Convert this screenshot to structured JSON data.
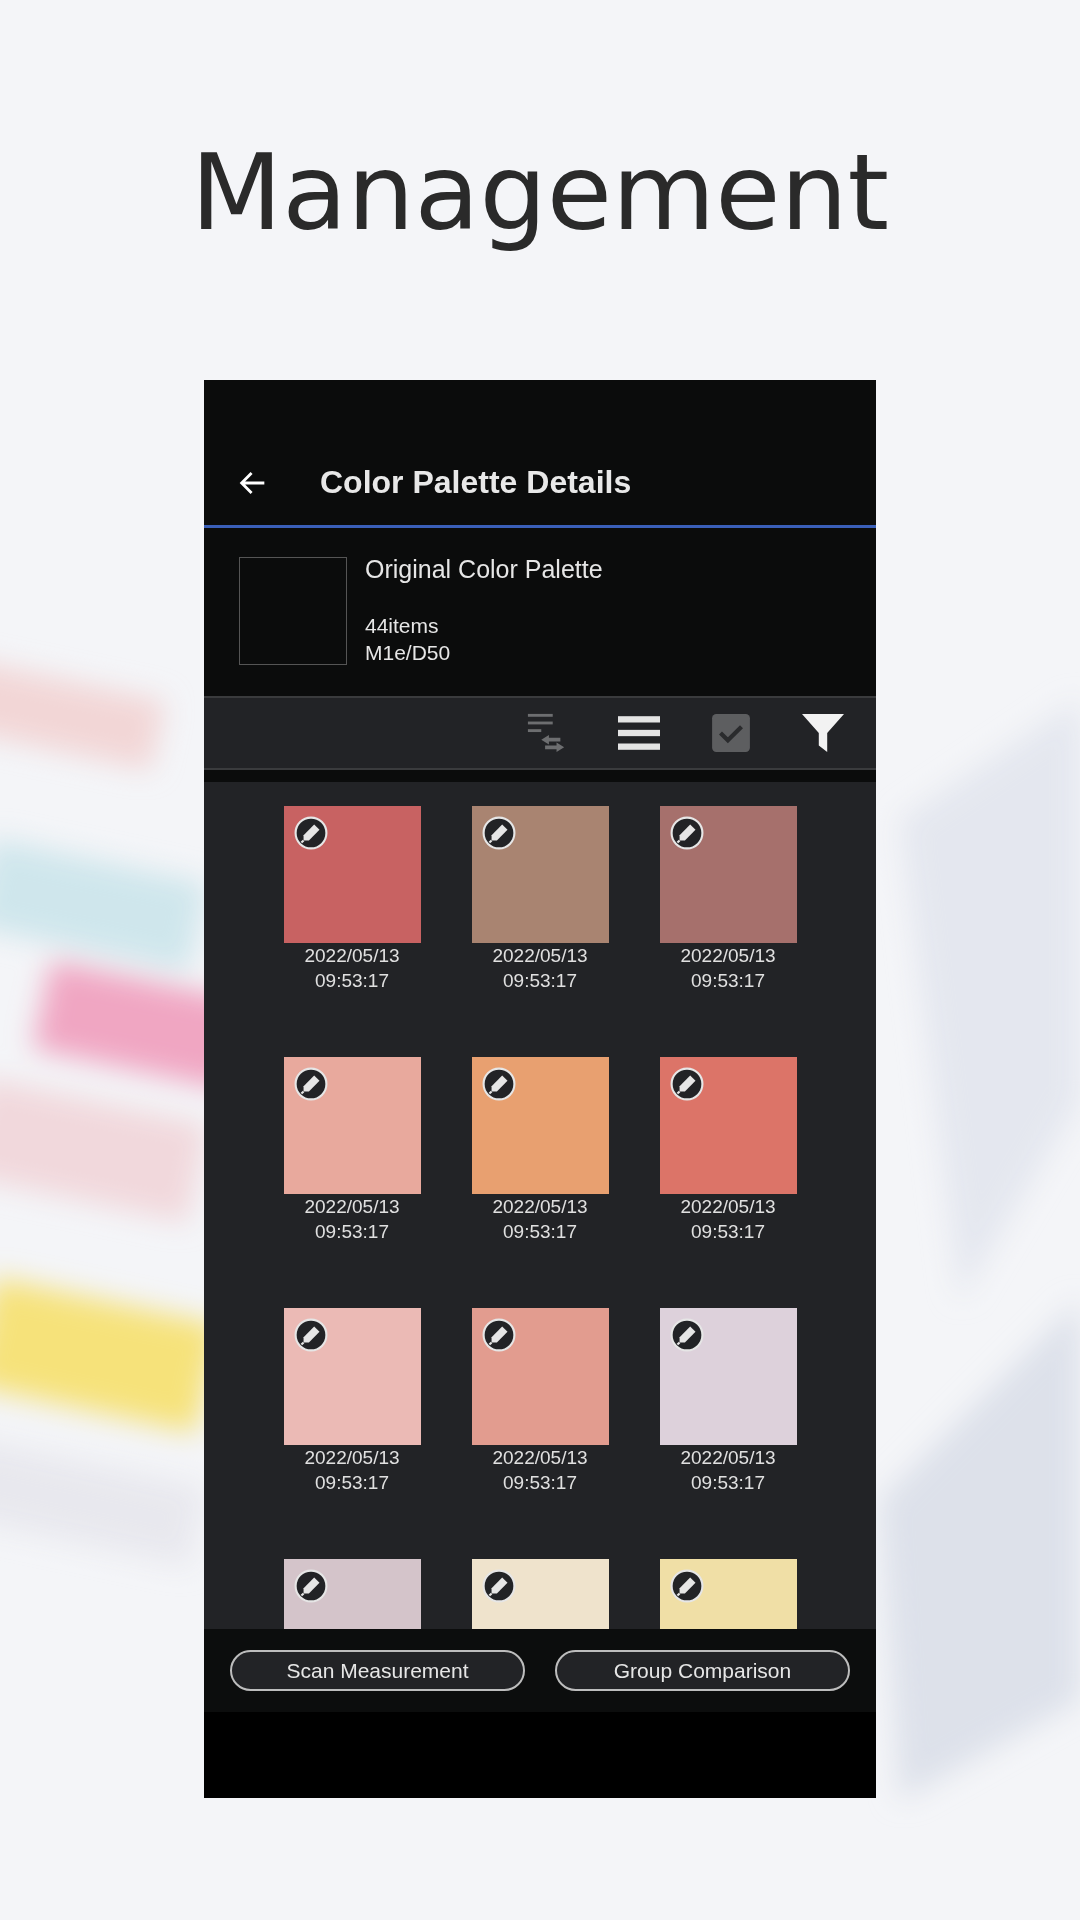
{
  "headline": "Management",
  "app_bar": {
    "title": "Color Palette Details"
  },
  "palette": {
    "name": "Original Color Palette",
    "count": "44items",
    "illuminant": "M1e/D50"
  },
  "swatches": [
    {
      "color": "#c86262",
      "date": "2022/05/13",
      "time": "09:53:17"
    },
    {
      "color": "#a98471",
      "date": "2022/05/13",
      "time": "09:53:17"
    },
    {
      "color": "#a6706c",
      "date": "2022/05/13",
      "time": "09:53:17"
    },
    {
      "color": "#e8a99d",
      "date": "2022/05/13",
      "time": "09:53:17"
    },
    {
      "color": "#e8a070",
      "date": "2022/05/13",
      "time": "09:53:17"
    },
    {
      "color": "#dc7468",
      "date": "2022/05/13",
      "time": "09:53:17"
    },
    {
      "color": "#ebbab5",
      "date": "2022/05/13",
      "time": "09:53:17"
    },
    {
      "color": "#e29c8f",
      "date": "2022/05/13",
      "time": "09:53:17"
    },
    {
      "color": "#ddd1db",
      "date": "2022/05/13",
      "time": "09:53:17"
    },
    {
      "color": "#d4c4ca"
    },
    {
      "color": "#efe3cc"
    },
    {
      "color": "#f0dfa6"
    }
  ],
  "buttons": [
    "Scan Measurement",
    "Group Comparison"
  ]
}
